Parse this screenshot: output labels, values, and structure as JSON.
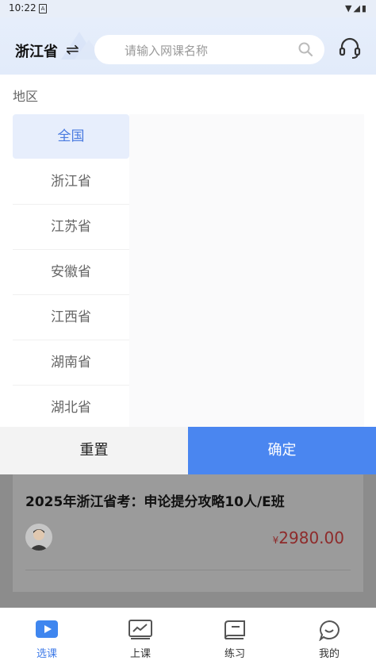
{
  "status_bar": {
    "time": "10:22"
  },
  "header": {
    "province": "浙江省",
    "search_placeholder": "请输入网课名称"
  },
  "region_panel": {
    "title": "地区",
    "items": [
      {
        "label": "全国",
        "selected": true
      },
      {
        "label": "浙江省",
        "selected": false
      },
      {
        "label": "江苏省",
        "selected": false
      },
      {
        "label": "安徽省",
        "selected": false
      },
      {
        "label": "江西省",
        "selected": false
      },
      {
        "label": "湖南省",
        "selected": false
      },
      {
        "label": "湖北省",
        "selected": false
      }
    ]
  },
  "actions": {
    "reset": "重置",
    "confirm": "确定"
  },
  "course": {
    "title": "2025年浙江省考：申论提分攻略10人/E班",
    "currency": "¥",
    "price": "2980.00"
  },
  "bottom_nav": [
    {
      "label": "选课",
      "icon": "play-icon",
      "active": true
    },
    {
      "label": "上课",
      "icon": "monitor-icon",
      "active": false
    },
    {
      "label": "练习",
      "icon": "book-icon",
      "active": false
    },
    {
      "label": "我的",
      "icon": "chat-icon",
      "active": false
    }
  ],
  "colors": {
    "accent": "#4a86f0",
    "price": "#c0392b",
    "selected_bg": "#e7eefc"
  }
}
